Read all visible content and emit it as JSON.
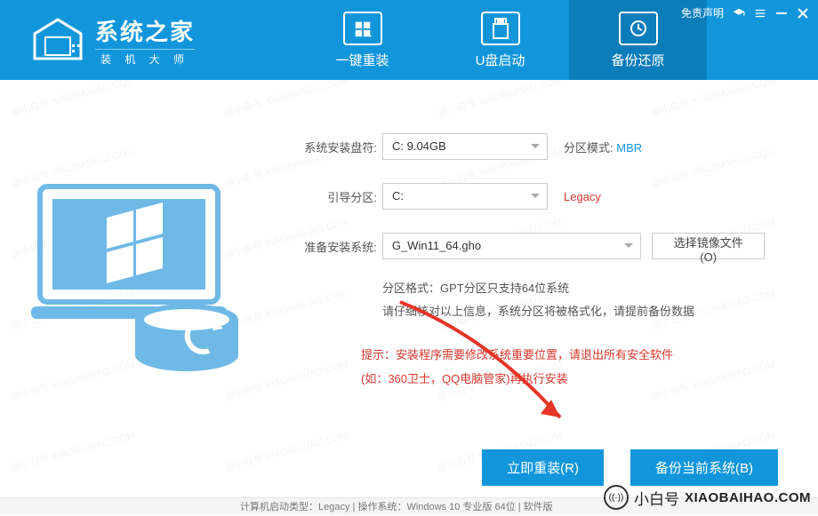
{
  "topbar": {
    "disclaimer": "免责声明"
  },
  "logo": {
    "title": "系统之家",
    "subtitle": "装 机 大 师"
  },
  "nav": {
    "reinstall": "一键重装",
    "usb": "U盘启动",
    "backup": "备份还原"
  },
  "form": {
    "drive_label": "系统安装盘符:",
    "drive_value": "C: 9.04GB",
    "partition_mode_label": "分区模式:",
    "partition_mode_value": "MBR",
    "boot_label": "引导分区:",
    "boot_value": "C:",
    "boot_mode": "Legacy",
    "install_label": "准备安装系统:",
    "install_value": "G_Win11_64.gho",
    "choose_image": "选择镜像文件(O)"
  },
  "info": {
    "line1": "分区格式：GPT分区只支持64位系统",
    "line2": "请仔细核对以上信息，系统分区将被格式化，请提前备份数据"
  },
  "warn": {
    "line1": "提示：安装程序需要修改系统重要位置，请退出所有安全软件",
    "line2": "(如：360卫士，QQ电脑管家)再执行安装"
  },
  "actions": {
    "reinstall_now": "立即重装(R)",
    "backup_current": "备份当前系统(B)"
  },
  "statusbar": "计算机启动类型：Legacy | 操作系统：Windows 10 专业版 64位 | 软件版",
  "watermark": {
    "cn": "小白号",
    "en": "XIAOBAIHAO.COM",
    "item": "@小白号  XIAOBAIHAO.COM"
  }
}
